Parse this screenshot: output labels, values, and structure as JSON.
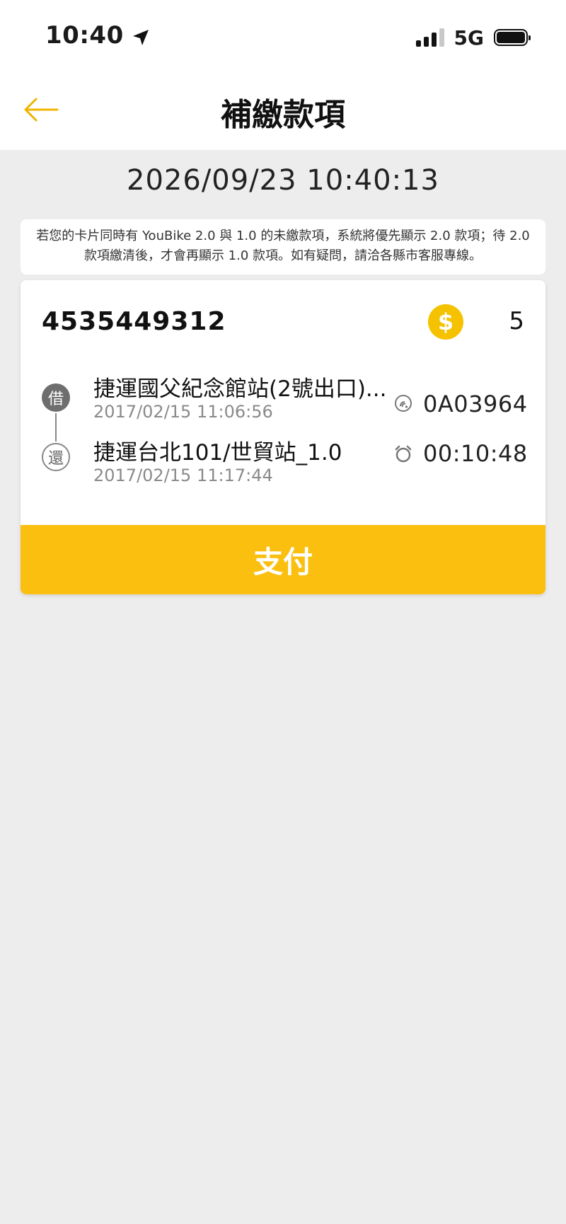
{
  "status_bar": {
    "time": "10:40",
    "network": "5G"
  },
  "header": {
    "title": "補繳款項",
    "back_icon": "arrow-left-icon"
  },
  "datetime": "2026/09/23 10:40:13",
  "notice": "若您的卡片同時有 YouBike 2.0 與 1.0 的未繳款項，系統將優先顯示 2.0 款項；待 2.0 款項繳清後，才會再顯示 1.0 款項。如有疑問，請洽各縣市客服專線。",
  "record": {
    "card_number": "4535449312",
    "coin_symbol": "$",
    "amount": "5",
    "borrow_label": "借",
    "return_label": "還",
    "borrow_station": "捷運國父紀念館站(2號出口)...",
    "borrow_time": "2017/02/15 11:06:56",
    "return_station": "捷運台北101/世貿站_1.0",
    "return_time": "2017/02/15 11:17:44",
    "bike_id": "0A03964",
    "duration": "00:10:48",
    "pay_label": "支付"
  },
  "colors": {
    "accent": "#fbbf10",
    "coin": "#f5c200",
    "back_arrow": "#f0b400",
    "background": "#ededed"
  }
}
